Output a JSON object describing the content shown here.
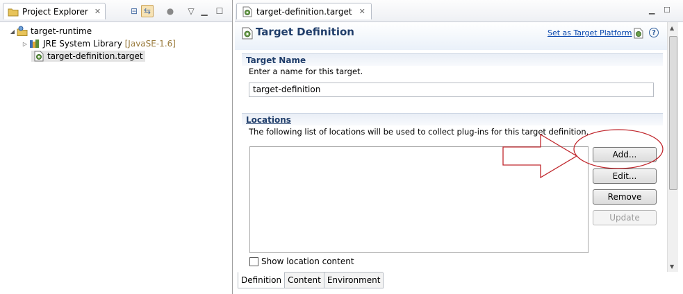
{
  "explorer": {
    "title": "Project Explorer",
    "tree": {
      "project": "target-runtime",
      "jre_label": "JRE System Library",
      "jre_version": "[JavaSE-1.6]",
      "file": "target-definition.target"
    }
  },
  "editor": {
    "tab_label": "target-definition.target",
    "form_title": "Target Definition",
    "set_platform_link": "Set as Target Platform",
    "help_label": "?",
    "target_name": {
      "heading": "Target Name",
      "description": "Enter a name for this target.",
      "value": "target-definition"
    },
    "locations": {
      "heading": "Locations",
      "description": "The following list of locations will be used to collect plug-ins for this target definition.",
      "buttons": {
        "add": "Add...",
        "edit": "Edit...",
        "remove": "Remove",
        "update": "Update"
      },
      "show_content_label": "Show location content"
    },
    "bottom_tabs": [
      "Definition",
      "Content",
      "Environment"
    ]
  },
  "colors": {
    "title": "#1f3d6a",
    "link": "#0645ad",
    "annotation": "#c0272d"
  }
}
